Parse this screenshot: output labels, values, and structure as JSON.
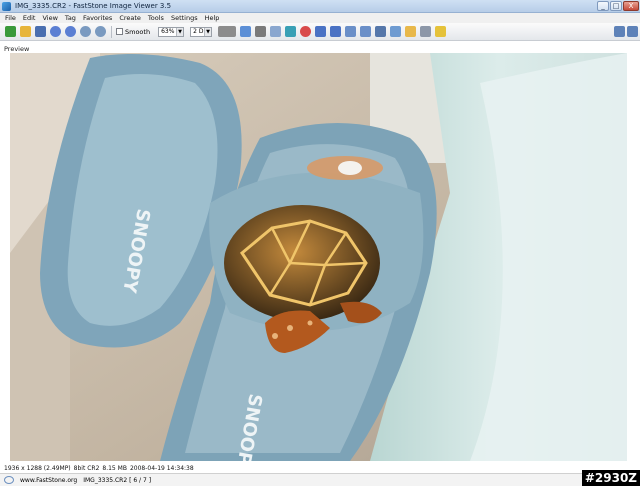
{
  "window": {
    "title": "IMG_3335.CR2  -  FastStone Image Viewer 3.5",
    "controls": {
      "minimize": "_",
      "maximize": "□",
      "close": "X"
    }
  },
  "menu": [
    "File",
    "Edit",
    "View",
    "Tag",
    "Favorites",
    "Create",
    "Tools",
    "Settings",
    "Help"
  ],
  "toolbar": {
    "smooth_label": "Smooth",
    "zoom_value": "63%",
    "mode_value": "2 D"
  },
  "panel": {
    "preview_label": "Preview"
  },
  "status": {
    "dimensions": "1936 x 1288 (2.49MP)",
    "format": "8bit CR2",
    "size": "8.15 MB",
    "datetime": "2008-04-19 14:34:38",
    "website": "www.FastStone.org",
    "file": "IMG_3335.CR2 [ 6 / 7 ]"
  },
  "badge": "#2930Z",
  "colors": {
    "accent": "#4a90d9",
    "slipper": "#7ea4b8",
    "floor": "#c9bcaa"
  }
}
